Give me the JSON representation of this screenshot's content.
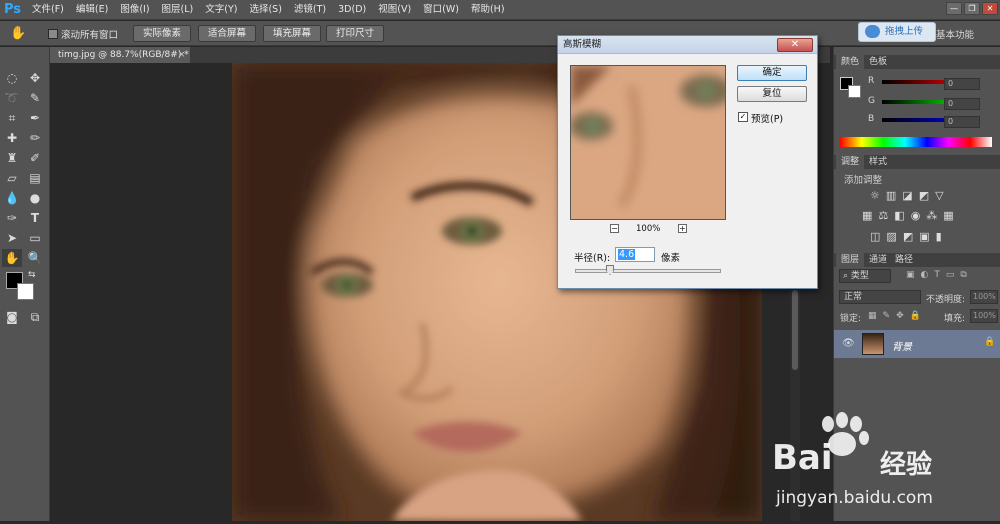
{
  "app": {
    "logo": "Ps"
  },
  "menu": [
    "文件(F)",
    "编辑(E)",
    "图像(I)",
    "图层(L)",
    "文字(Y)",
    "选择(S)",
    "滤镜(T)",
    "3D(D)",
    "视图(V)",
    "窗口(W)",
    "帮助(H)"
  ],
  "window_controls": [
    "—",
    "❐",
    "✕"
  ],
  "options": {
    "scroll_all_label": "滚动所有窗口",
    "buttons": [
      "实际像素",
      "适合屏幕",
      "填充屏幕",
      "打印尺寸"
    ],
    "drag_upload": "拖拽上传",
    "workspace": "基本功能"
  },
  "document": {
    "tab_title": "timg.jpg @ 88.7%(RGB/8#) *",
    "close": "×"
  },
  "color_panel": {
    "tabs": [
      "颜色",
      "色板"
    ],
    "channels": [
      {
        "name": "R",
        "value": "0",
        "color": "#ff0000"
      },
      {
        "name": "G",
        "value": "0",
        "color": "#00ff00"
      },
      {
        "name": "B",
        "value": "0",
        "color": "#0000ff"
      }
    ]
  },
  "adjustments_panel": {
    "tabs": [
      "调整",
      "样式"
    ],
    "title": "添加调整"
  },
  "layers_panel": {
    "tabs": [
      "图层",
      "通道",
      "路径"
    ],
    "filter": "类型",
    "blend_mode": "正常",
    "opacity_label": "不透明度:",
    "opacity_value": "100%",
    "lock_label": "锁定:",
    "fill_label": "填充:",
    "fill_value": "100%",
    "layers": [
      {
        "name": "背景",
        "locked": true
      }
    ]
  },
  "dialog": {
    "title": "高斯模糊",
    "ok": "确定",
    "reset": "复位",
    "preview_label": "预览(P)",
    "preview_checked": true,
    "zoom": "100%",
    "radius_label": "半径(R):",
    "radius_value": "4.6",
    "radius_unit": "像素"
  },
  "watermark": {
    "brand": "Bai",
    "brand2": "经验",
    "url": "jingyan.baidu.com"
  }
}
